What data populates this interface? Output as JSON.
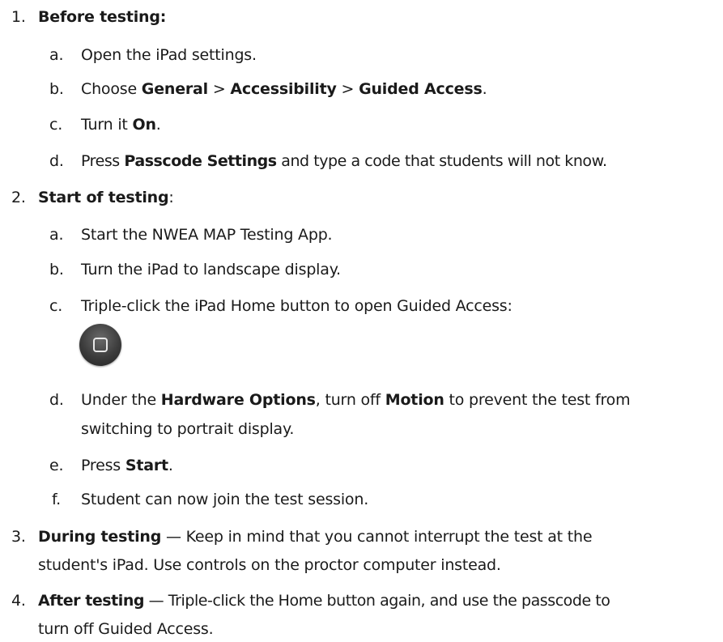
{
  "steps": [
    {
      "number": "1.",
      "title": "Before testing",
      "title_suffix": ":",
      "substeps": [
        {
          "letter": "a.",
          "parts": [
            "Open the iPad settings."
          ]
        },
        {
          "letter": "b.",
          "parts": [
            "Choose ",
            "General",
            " > ",
            "Accessibility",
            " > ",
            "Guided Access",
            "."
          ]
        },
        {
          "letter": "c.",
          "parts": [
            "Turn it ",
            "On",
            "."
          ]
        },
        {
          "letter": "d.",
          "parts": [
            "Press ",
            "Passcode Settings",
            " and type a code that students will not know."
          ]
        }
      ]
    },
    {
      "number": "2.",
      "title": "Start of testing",
      "title_suffix": ":",
      "substeps": [
        {
          "letter": "a.",
          "parts": [
            "Start the NWEA MAP Testing App."
          ]
        },
        {
          "letter": "b.",
          "parts": [
            "Turn the iPad to landscape display."
          ]
        },
        {
          "letter": "c.",
          "parts": [
            "Triple-click the iPad Home button to open Guided Access:"
          ]
        },
        {
          "letter": "d.",
          "parts": [
            "Under the ",
            "Hardware Options",
            ", turn off ",
            "Motion",
            " to prevent the test from"
          ],
          "line2": "switching to portrait display."
        },
        {
          "letter": "e.",
          "parts": [
            "Press ",
            "Start",
            "."
          ]
        },
        {
          "letter": "f.",
          "parts": [
            "Student can now join the test session."
          ]
        }
      ]
    },
    {
      "number": "3.",
      "title": "During testing",
      "text": " — Keep in mind that you cannot interrupt the test at the",
      "line2": "student's iPad. Use controls on the proctor computer instead."
    },
    {
      "number": "4.",
      "title": "After testing",
      "text": " — Triple-click the Home button again, and use the passcode to",
      "line2": "turn off Guided Access."
    }
  ],
  "icons": {
    "home_button": "ipad-home-button-icon"
  }
}
